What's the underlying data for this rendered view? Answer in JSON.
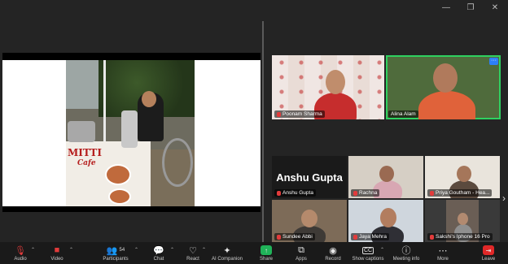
{
  "share": {
    "sign_main": "MITTI",
    "sign_sub": "Cafe"
  },
  "participants_top": [
    {
      "name": "Poonam Sharma"
    },
    {
      "name": "Alina Alam"
    }
  ],
  "participants_grid": [
    {
      "name": "Anshu Gupta",
      "display": "Anshu Gupta"
    },
    {
      "name": "Rachna"
    },
    {
      "name": "Priya Goutham - Hea..."
    },
    {
      "name": "Sundee Abbi"
    },
    {
      "name": "Jaya Mehra"
    },
    {
      "name": "Sakshi's Iphone 16 Pro"
    }
  ],
  "toolbar": {
    "audio": "Audio",
    "video": "Video",
    "participants": "Participants",
    "participants_count": "54",
    "chat": "Chat",
    "react": "React",
    "ai_companion": "AI Companion",
    "share": "Share",
    "apps": "Apps",
    "record": "Record",
    "captions": "Show captions",
    "meeting_info": "Meeting info",
    "more": "More",
    "leave": "Leave"
  },
  "colors": {
    "active_speaker": "#2fd160",
    "share_button": "#20b359",
    "leave_button": "#e02828",
    "toolbar_bg": "#1a1a1a"
  }
}
